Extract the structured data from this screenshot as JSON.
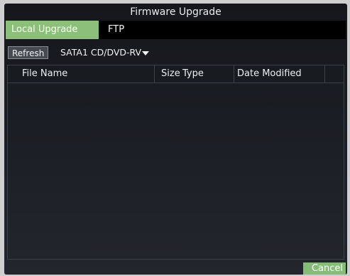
{
  "window": {
    "title": "Firmware Upgrade"
  },
  "tabs": [
    {
      "label": "Local Upgrade",
      "active": true
    },
    {
      "label": "FTP",
      "active": false
    }
  ],
  "toolbar": {
    "refresh_label": "Refresh",
    "device_selected": "SATA1 CD/DVD-RV"
  },
  "table": {
    "columns": {
      "name": "File Name",
      "size": "Size",
      "type": "Type",
      "date": "Date Modified"
    },
    "rows": []
  },
  "footer": {
    "cancel_label": "Cancel"
  },
  "colors": {
    "accent": "#8cc07a",
    "background": "#1d2026",
    "tabbar": "#000000"
  },
  "icons": {
    "dropdown": "triangle-down-icon"
  }
}
